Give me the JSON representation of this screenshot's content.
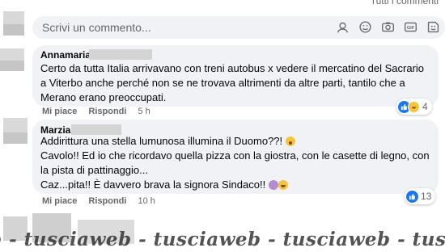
{
  "header": {
    "filter_label": "Tutti i commenti"
  },
  "composer": {
    "placeholder": "Scrivi un commento..."
  },
  "comments": [
    {
      "author": "Annamaria",
      "lines": [
        "Certo da tutta Italia arrivavano con treni autobus x vedere il mercatino del Sacrario",
        "a Viterbo anche perché non se ne trovava altrimenti da altre parti, tantilo che a",
        "Merano erano preoccupati."
      ],
      "like_label": "Mi piace",
      "reply_label": "Rispondi",
      "time": "5 h",
      "reaction_count": "4",
      "reaction_icons": [
        "like-icon",
        "haha-icon"
      ]
    },
    {
      "author": "Marzia",
      "lines": [
        "Addirittura una stella lumunosa illumina il Duomo??!",
        "Cavolo!! Ed io che ricordavo quella pizza con la giostra, con le casette di legno, con",
        "la pista di pattinaggio...",
        "Caz...pita!! È davvero brava la signora Sindaco!!"
      ],
      "like_label": "Mi piace",
      "reply_label": "Rispondi",
      "time": "10 h",
      "reaction_count": "13",
      "reaction_icons": [
        "like-icon"
      ]
    }
  ],
  "watermark": "b - tusciaweb - tusciaweb - tusciaweb - tusci",
  "colors": {
    "bubble": "#f0f2f5",
    "meta": "#65676b",
    "like_blue": "#1877f2"
  }
}
